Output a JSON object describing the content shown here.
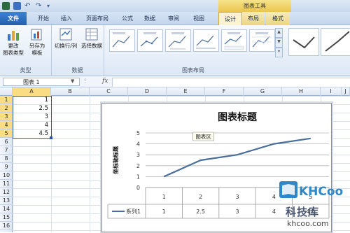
{
  "title_bar": {
    "context_tool_title": "图表工具"
  },
  "tabs": [
    {
      "label": "文件"
    },
    {
      "label": "开始"
    },
    {
      "label": "插入"
    },
    {
      "label": "页面布局"
    },
    {
      "label": "公式"
    },
    {
      "label": "数据"
    },
    {
      "label": "审阅"
    },
    {
      "label": "视图"
    },
    {
      "label": "设计"
    },
    {
      "label": "布局"
    },
    {
      "label": "格式"
    }
  ],
  "ribbon": {
    "type_group": {
      "label": "类型",
      "change_type": "更改\n图表类型",
      "save_template": "另存为\n模板"
    },
    "data_group": {
      "label": "数据",
      "switch_row_col": "切换行/列",
      "select_data": "选择数据"
    },
    "layout_group": {
      "label": "图表布局"
    }
  },
  "formula_bar": {
    "name_box": "图表 1",
    "fx": "fx"
  },
  "columns": [
    "A",
    "B",
    "C",
    "D",
    "E",
    "F",
    "G",
    "H",
    "I",
    "J"
  ],
  "rows": [
    "1",
    "2",
    "3",
    "4",
    "5",
    "6",
    "7",
    "8",
    "9",
    "10",
    "11",
    "12",
    "13",
    "14",
    "15",
    "16"
  ],
  "cells_A": [
    "1",
    "2.5",
    "3",
    "4",
    "4.5"
  ],
  "chart_data": {
    "type": "line",
    "title": "图表标题",
    "ylabel": "坐标轴标题",
    "ylim": [
      0,
      5
    ],
    "yticks": [
      "0",
      "1",
      "2",
      "3",
      "4",
      "5"
    ],
    "categories": [
      "1",
      "2",
      "3",
      "4",
      "5"
    ],
    "series": [
      {
        "name": "系列1",
        "values": [
          1,
          2.5,
          3,
          4,
          4.5
        ]
      }
    ],
    "tooltip": "图表区",
    "data_table": true,
    "grid": true,
    "line_color": "#4a6f9c"
  },
  "watermark": {
    "logo": "KHCoo",
    "name": "科技库",
    "url": "khcoo.com"
  }
}
